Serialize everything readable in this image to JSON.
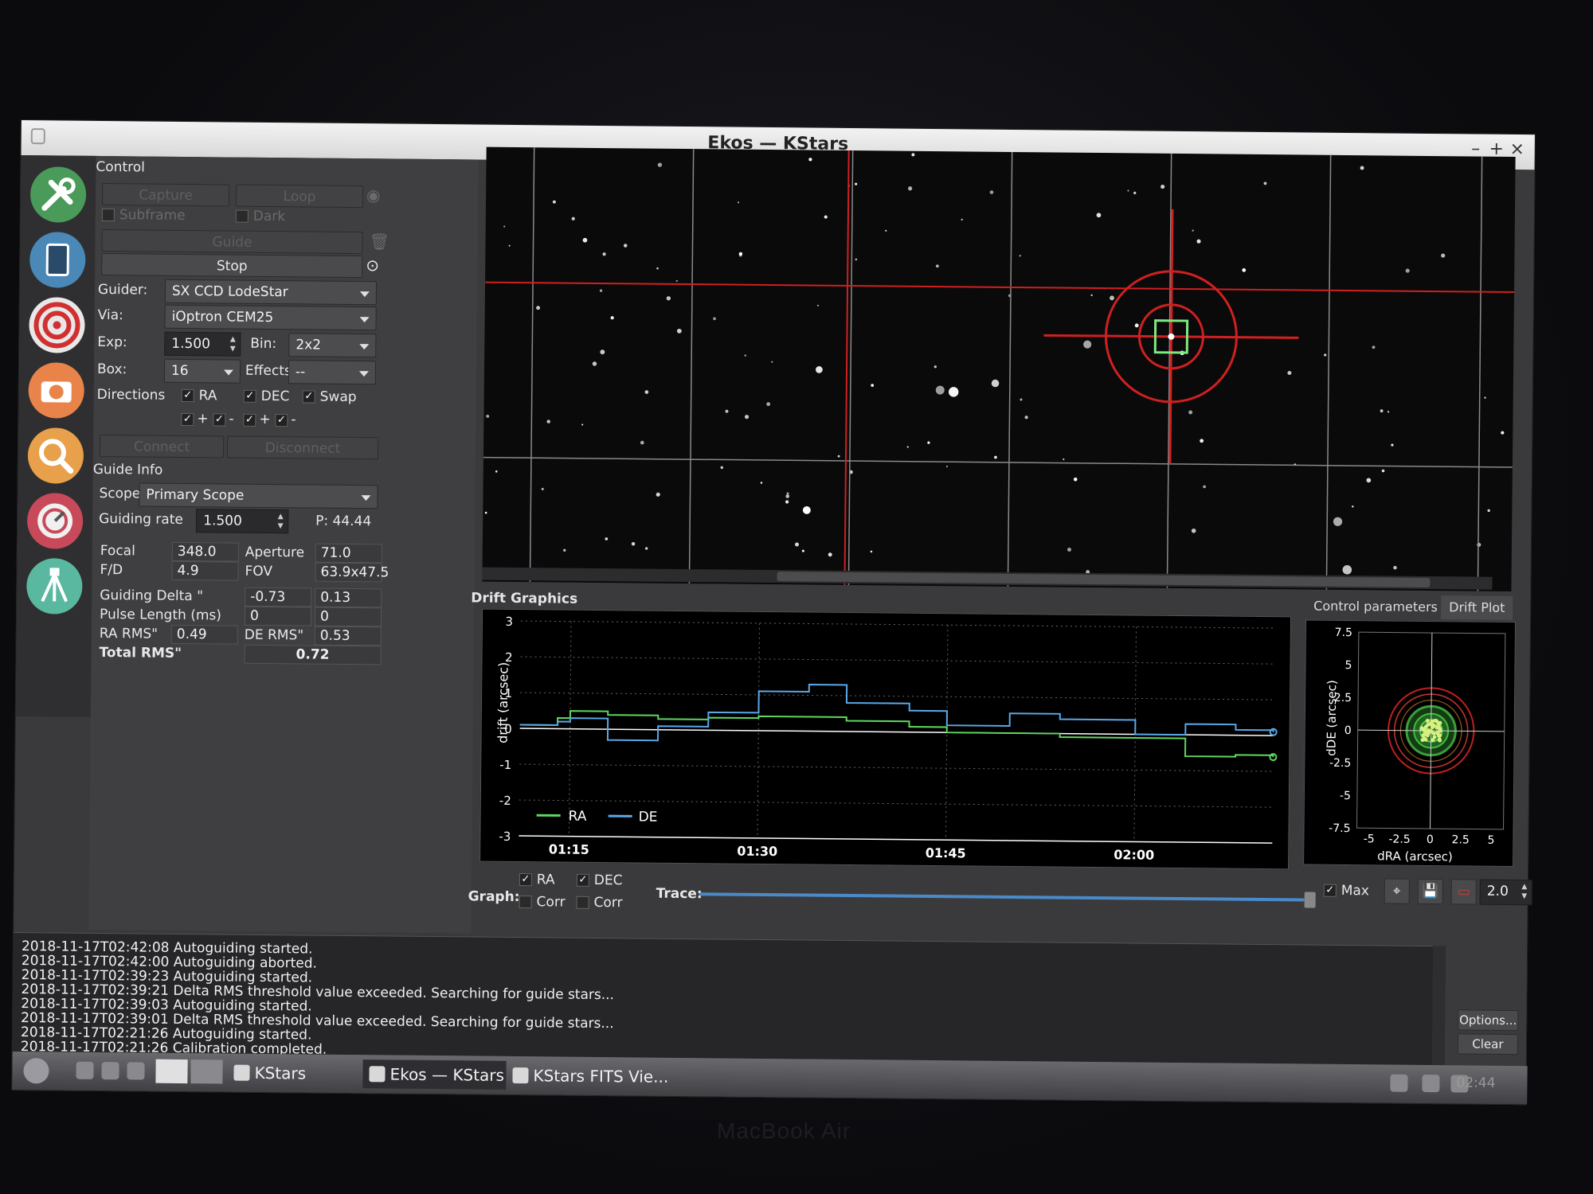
{
  "window": {
    "title": "Ekos — KStars",
    "minimize": "–",
    "maximize": "+",
    "close": "×"
  },
  "modules": [
    "setup",
    "scheduler",
    "focus",
    "capture",
    "align",
    "guide",
    "mount"
  ],
  "control": {
    "title": "Control",
    "capture_label": "Capture",
    "loop_label": "Loop",
    "subframe_label": "Subframe",
    "dark_label": "Dark",
    "guide_label": "Guide",
    "stop_label": "Stop",
    "guider_label": "Guider:",
    "guider_value": "SX CCD LodeStar",
    "via_label": "Via:",
    "via_value": "iOptron CEM25",
    "exp_label": "Exp:",
    "exp_value": "1.500",
    "bin_label": "Bin:",
    "bin_value": "2x2",
    "box_label": "Box:",
    "box_value": "16",
    "effects_label": "Effects",
    "effects_value": "--",
    "directions_label": "Directions",
    "ra_label": "RA",
    "dec_label": "DEC",
    "swap_label": "Swap",
    "plus": "+",
    "minus": "-",
    "connect_label": "Connect",
    "disconnect_label": "Disconnect"
  },
  "guide_info": {
    "title": "Guide Info",
    "scope_label": "Scope:",
    "scope_value": "Primary Scope",
    "rate_label": "Guiding rate",
    "rate_value": "1.500",
    "p_value": "P: 44.44",
    "focal_label": "Focal",
    "focal_value": "348.0",
    "aperture_label": "Aperture",
    "aperture_value": "71.0",
    "fd_label": "F/D",
    "fd_value": "4.9",
    "fov_label": "FOV",
    "fov_value": "63.9x47.5",
    "delta_label": "Guiding Delta \"",
    "delta_ra": "-0.73",
    "delta_de": "0.13",
    "pulse_label": "Pulse Length (ms)",
    "pulse_ra": "0",
    "pulse_de": "0",
    "ra_rms_label": "RA RMS\"",
    "ra_rms_value": "0.49",
    "de_rms_label": "DE RMS\"",
    "de_rms_value": "0.53",
    "total_rms_label": "Total RMS\"",
    "total_rms_value": "0.72"
  },
  "drift": {
    "title": "Drift Graphics",
    "ylabel": "drift (arcsec)",
    "yticks": [
      "3",
      "2",
      "1",
      "0",
      "-1",
      "-2",
      "-3"
    ],
    "xticks": [
      "01:15",
      "01:30",
      "01:45",
      "02:00"
    ],
    "legend_ra": "RA",
    "legend_de": "DE",
    "colors": {
      "ra": "#5fd85f",
      "de": "#5aa8e8"
    }
  },
  "chart_data": {
    "type": "line",
    "ylabel": "drift (arcsec)",
    "ylim": [
      -3,
      3
    ],
    "x": [
      "01:11",
      "01:14",
      "01:15",
      "01:18",
      "01:22",
      "01:26",
      "01:30",
      "01:34",
      "01:37",
      "01:42",
      "01:45",
      "01:50",
      "01:54",
      "02:00",
      "02:04",
      "02:08",
      "02:11"
    ],
    "series": [
      {
        "name": "RA",
        "values": [
          0.1,
          0.3,
          0.5,
          0.4,
          0.3,
          0.35,
          0.4,
          0.4,
          0.3,
          0.15,
          0.0,
          0.0,
          -0.1,
          -0.1,
          -0.6,
          -0.55,
          -0.6
        ]
      },
      {
        "name": "DE",
        "values": [
          0.1,
          0.2,
          0.3,
          -0.3,
          0.1,
          0.5,
          1.1,
          1.3,
          0.8,
          0.6,
          0.2,
          0.55,
          0.4,
          0.0,
          0.3,
          0.15,
          0.1
        ]
      }
    ]
  },
  "right_panel": {
    "tab_control": "Control parameters",
    "tab_drift": "Drift Plot",
    "ylabel": "dDE (arcsec)",
    "xlabel": "dRA (arcsec)",
    "yticks": [
      "7.5",
      "5",
      "2.5",
      "0",
      "-2.5",
      "-5",
      "-7.5"
    ],
    "xticks": [
      "-5",
      "-2.5",
      "0",
      "2.5",
      "5"
    ]
  },
  "graph_controls": {
    "graph_label": "Graph:",
    "ra_label": "RA",
    "dec_label": "DEC",
    "corr_label": "Corr",
    "trace_label": "Trace:",
    "max_label": "Max",
    "zoom_value": "2.0"
  },
  "log": {
    "lines": [
      "2018-11-17T02:42:08 Autoguiding started.",
      "2018-11-17T02:42:00 Autoguiding aborted.",
      "2018-11-17T02:39:23 Autoguiding started.",
      "2018-11-17T02:39:21 Delta RMS threshold value exceeded. Searching for guide stars...",
      "2018-11-17T02:39:03 Autoguiding started.",
      "2018-11-17T02:39:01 Delta RMS threshold value exceeded. Searching for guide stars...",
      "2018-11-17T02:21:26 Autoguiding started.",
      "2018-11-17T02:21:26 Calibration completed."
    ],
    "options_label": "Options...",
    "clear_label": "Clear"
  },
  "taskbar": {
    "tasks": [
      "KStars",
      "Ekos — KStars",
      "KStars FITS Vie..."
    ],
    "clock": "02:44"
  },
  "bezel_text": "MacBook Air"
}
